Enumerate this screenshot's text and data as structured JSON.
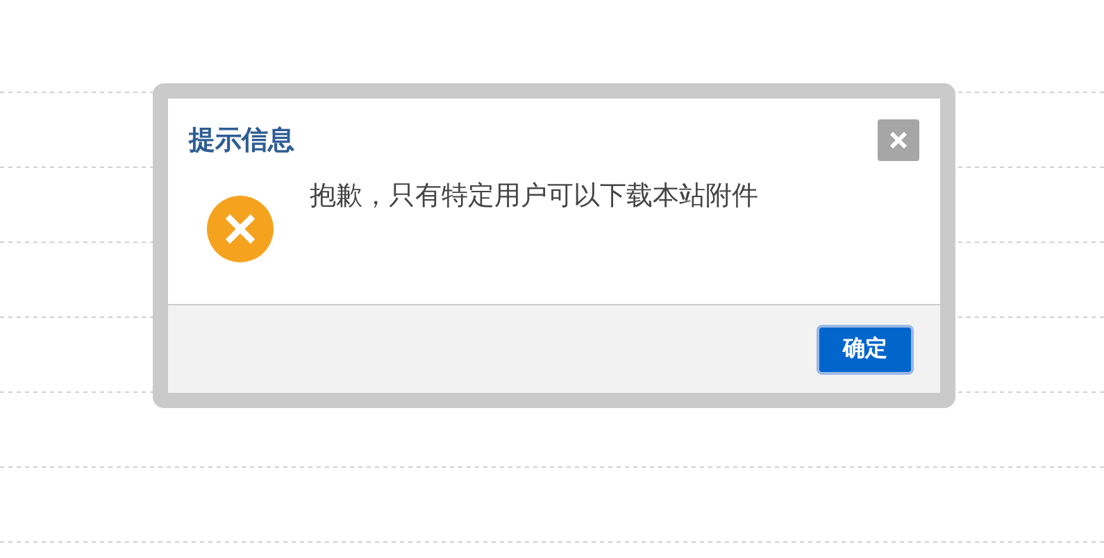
{
  "dialog": {
    "title": "提示信息",
    "message": "抱歉，只有特定用户可以下载本站附件",
    "buttons": [
      {
        "label": "确定"
      }
    ]
  }
}
